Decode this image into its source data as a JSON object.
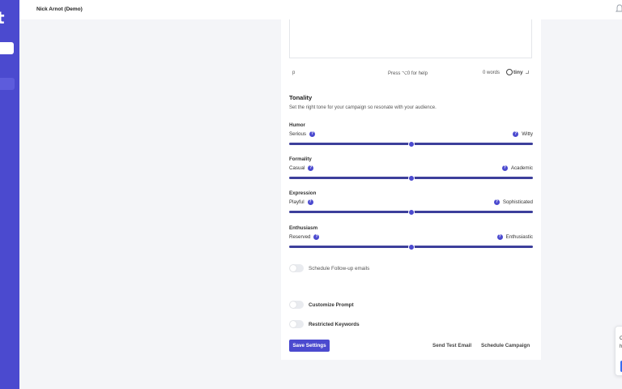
{
  "sidebar": {
    "logo": "t"
  },
  "header": {
    "user": "Nick Arnot (Demo)",
    "bell_icon": "bell-icon"
  },
  "editor": {
    "path": "p",
    "help": "Press ⌥0 for help",
    "words": "0 words",
    "brand": "tiny"
  },
  "tonality": {
    "title": "Tonality",
    "description": "Set the right tone for your campaign so resonate with your audience.",
    "sliders": [
      {
        "name": "Humor",
        "low": "Serious",
        "high": "Witty",
        "value": 0.5
      },
      {
        "name": "Formality",
        "low": "Casual",
        "high": "Academic",
        "value": 0.5
      },
      {
        "name": "Expression",
        "low": "Playful",
        "high": "Sophisticated",
        "value": 0.5
      },
      {
        "name": "Enthusiasm",
        "low": "Reserved",
        "high": "Enthusiastic",
        "value": 0.5
      }
    ]
  },
  "toggles": {
    "followup": "Schedule Follow-up emails",
    "customize": "Customize Prompt",
    "restricted": "Restricted Keywords"
  },
  "actions": {
    "save": "Save Settings",
    "test": "Send Test Email",
    "schedule": "Schedule Campaign"
  },
  "widget": {
    "line1": "C",
    "line2": "h"
  },
  "help_icon_glyph": "?",
  "colors": {
    "accent": "#4b4acf",
    "track": "#3d3f9b"
  }
}
